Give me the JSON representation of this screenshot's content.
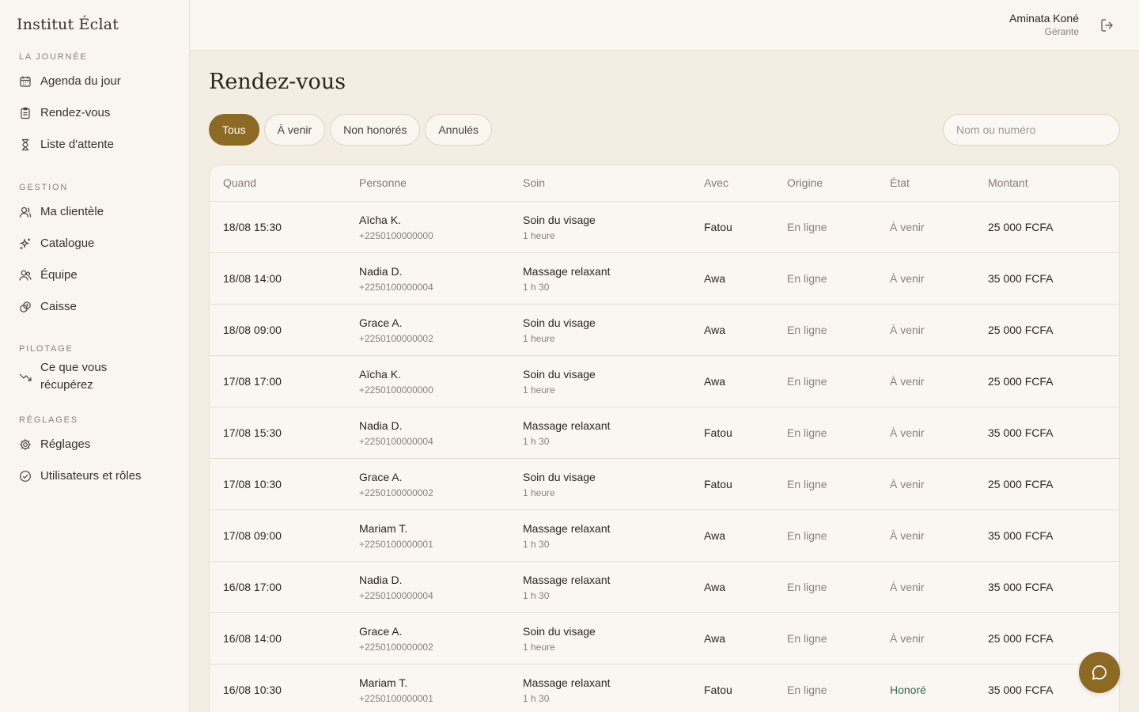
{
  "brand": "Institut Éclat",
  "sidebar": {
    "sections": [
      {
        "title": "LA JOURNÉE",
        "items": [
          {
            "label": "Agenda du jour",
            "icon": "calendar-icon"
          },
          {
            "label": "Rendez-vous",
            "icon": "clipboard-icon"
          },
          {
            "label": "Liste d'attente",
            "icon": "hourglass-icon"
          }
        ]
      },
      {
        "title": "GESTION",
        "items": [
          {
            "label": "Ma clientèle",
            "icon": "user-icon"
          },
          {
            "label": "Catalogue",
            "icon": "sparkles-icon"
          },
          {
            "label": "Équipe",
            "icon": "users-icon"
          },
          {
            "label": "Caisse",
            "icon": "coins-icon"
          }
        ]
      },
      {
        "title": "PILOTAGE",
        "items": [
          {
            "label_line1": "Ce que vous",
            "label_line2": "récupérez",
            "icon": "trending-down-icon"
          }
        ]
      },
      {
        "title": "RÉGLAGES",
        "items": [
          {
            "label": "Réglages",
            "icon": "gear-icon"
          },
          {
            "label": "Utilisateurs et rôles",
            "icon": "check-circle-icon"
          }
        ]
      }
    ]
  },
  "topbar": {
    "user_name": "Aminata Koné",
    "user_role": "Gérante",
    "logout_icon": "logout-icon"
  },
  "page": {
    "title": "Rendez-vous"
  },
  "filters": [
    {
      "label": "Tous",
      "active": true
    },
    {
      "label": "À venir",
      "active": false
    },
    {
      "label": "Non honorés",
      "active": false
    },
    {
      "label": "Annulés",
      "active": false
    }
  ],
  "search": {
    "placeholder": "Nom ou numéro",
    "value": ""
  },
  "table": {
    "headers": [
      "Quand",
      "Personne",
      "Soin",
      "Avec",
      "Origine",
      "État",
      "Montant"
    ],
    "rows": [
      {
        "when": "18/08 15:30",
        "name": "Aïcha K.",
        "phone": "+2250100000000",
        "service": "Soin du visage",
        "duration": "1 heure",
        "with": "Fatou",
        "origin": "En ligne",
        "state": "À venir",
        "amount": "25 000 FCFA"
      },
      {
        "when": "18/08 14:00",
        "name": "Nadia D.",
        "phone": "+2250100000004",
        "service": "Massage relaxant",
        "duration": "1 h 30",
        "with": "Awa",
        "origin": "En ligne",
        "state": "À venir",
        "amount": "35 000 FCFA"
      },
      {
        "when": "18/08 09:00",
        "name": "Grace A.",
        "phone": "+2250100000002",
        "service": "Soin du visage",
        "duration": "1 heure",
        "with": "Awa",
        "origin": "En ligne",
        "state": "À venir",
        "amount": "25 000 FCFA"
      },
      {
        "when": "17/08 17:00",
        "name": "Aïcha K.",
        "phone": "+2250100000000",
        "service": "Soin du visage",
        "duration": "1 heure",
        "with": "Awa",
        "origin": "En ligne",
        "state": "À venir",
        "amount": "25 000 FCFA"
      },
      {
        "when": "17/08 15:30",
        "name": "Nadia D.",
        "phone": "+2250100000004",
        "service": "Massage relaxant",
        "duration": "1 h 30",
        "with": "Fatou",
        "origin": "En ligne",
        "state": "À venir",
        "amount": "35 000 FCFA"
      },
      {
        "when": "17/08 10:30",
        "name": "Grace A.",
        "phone": "+2250100000002",
        "service": "Soin du visage",
        "duration": "1 heure",
        "with": "Fatou",
        "origin": "En ligne",
        "state": "À venir",
        "amount": "25 000 FCFA"
      },
      {
        "when": "17/08 09:00",
        "name": "Mariam T.",
        "phone": "+2250100000001",
        "service": "Massage relaxant",
        "duration": "1 h 30",
        "with": "Awa",
        "origin": "En ligne",
        "state": "À venir",
        "amount": "35 000 FCFA"
      },
      {
        "when": "16/08 17:00",
        "name": "Nadia D.",
        "phone": "+2250100000004",
        "service": "Massage relaxant",
        "duration": "1 h 30",
        "with": "Awa",
        "origin": "En ligne",
        "state": "À venir",
        "amount": "35 000 FCFA"
      },
      {
        "when": "16/08 14:00",
        "name": "Grace A.",
        "phone": "+2250100000002",
        "service": "Soin du visage",
        "duration": "1 heure",
        "with": "Awa",
        "origin": "En ligne",
        "state": "À venir",
        "amount": "25 000 FCFA"
      },
      {
        "when": "16/08 10:30",
        "name": "Mariam T.",
        "phone": "+2250100000001",
        "service": "Massage relaxant",
        "duration": "1 h 30",
        "with": "Fatou",
        "origin": "En ligne",
        "state": "Honoré",
        "amount": "35 000 FCFA"
      }
    ]
  },
  "chat": {
    "icon": "chat-bubble-icon"
  },
  "colors": {
    "accent": "#8d6a23",
    "honored": "#2f6b50",
    "background": "#f3ede3",
    "sidebar": "#f9f6f0"
  }
}
